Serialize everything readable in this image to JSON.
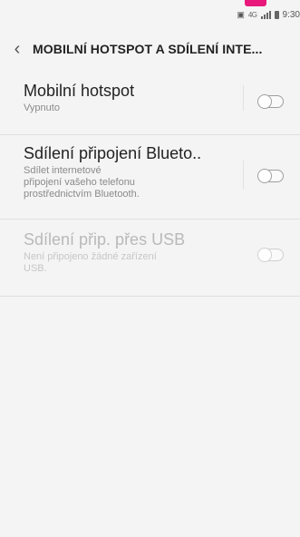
{
  "status_bar": {
    "signal_text": "4G",
    "time": "9:30"
  },
  "header": {
    "back_icon": "chevron-left-icon",
    "title": "MOBILNÍ HOTSPOT A SDÍLENÍ INTE..."
  },
  "settings": [
    {
      "title": "Mobilní hotspot",
      "subtitle": "Vypnuto",
      "toggle": "off",
      "enabled": true
    },
    {
      "title": "Sdílení připojení Blueto..",
      "subtitle": "Sdílet internetové připojení vašeho telefonu prostřednictvím Bluetooth.",
      "toggle": "off",
      "enabled": true
    },
    {
      "title": "Sdílení přip. přes USB",
      "subtitle": "Není připojeno žádné zařízení USB.",
      "toggle": "off",
      "enabled": false
    }
  ],
  "colors": {
    "background": "#f4f4f4",
    "accent": "#e8197a",
    "toggle_off": "#9f9f9f"
  }
}
